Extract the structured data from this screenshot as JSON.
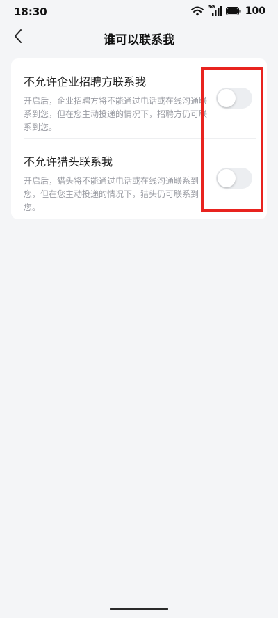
{
  "status_bar": {
    "time": "18:30",
    "network_label": "5G",
    "battery": "100"
  },
  "header": {
    "title": "谁可以联系我",
    "back_icon": "chevron-left-icon"
  },
  "settings": [
    {
      "title": "不允许企业招聘方联系我",
      "description": "开启后，企业招聘方将不能通过电话或在线沟通联系到您，但在您主动投递的情况下，招聘方仍可联系到您。",
      "enabled": false
    },
    {
      "title": "不允许猎头联系我",
      "description": "开启后，猎头将不能通过电话或在线沟通联系到您，但在您主动投递的情况下，猎头仍可联系到您。",
      "enabled": false
    }
  ],
  "colors": {
    "background": "#f4f5f7",
    "card": "#ffffff",
    "highlight": "#e8231f",
    "toggle_off": "#eceef1"
  }
}
